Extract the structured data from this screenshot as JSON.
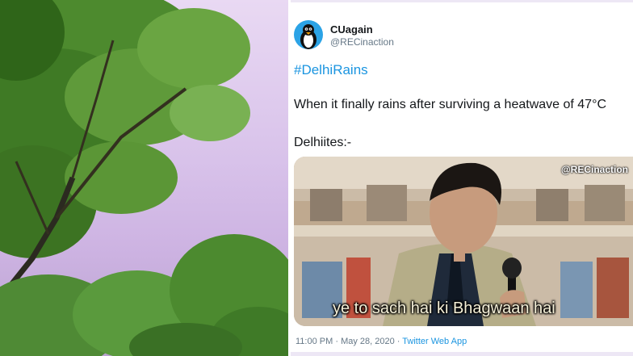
{
  "tweet": {
    "display_name": "CUagain",
    "handle": "@RECinaction",
    "hashtag": "#DelhiRains",
    "text": "When it finally rains after surviving a heatwave of 47°C",
    "subtext": "Delhiites:-",
    "media": {
      "watermark": "@RECinaction",
      "caption": "ye to sach hai ki Bhagwaan hai"
    },
    "time": "11:00 PM",
    "separator": " · ",
    "date": "May 28, 2020",
    "source": "Twitter Web App"
  },
  "colors": {
    "link": "#1b95e0",
    "secondary_text": "#657786",
    "primary_text": "#14171a",
    "avatar_bg": "#2ba3e6"
  }
}
